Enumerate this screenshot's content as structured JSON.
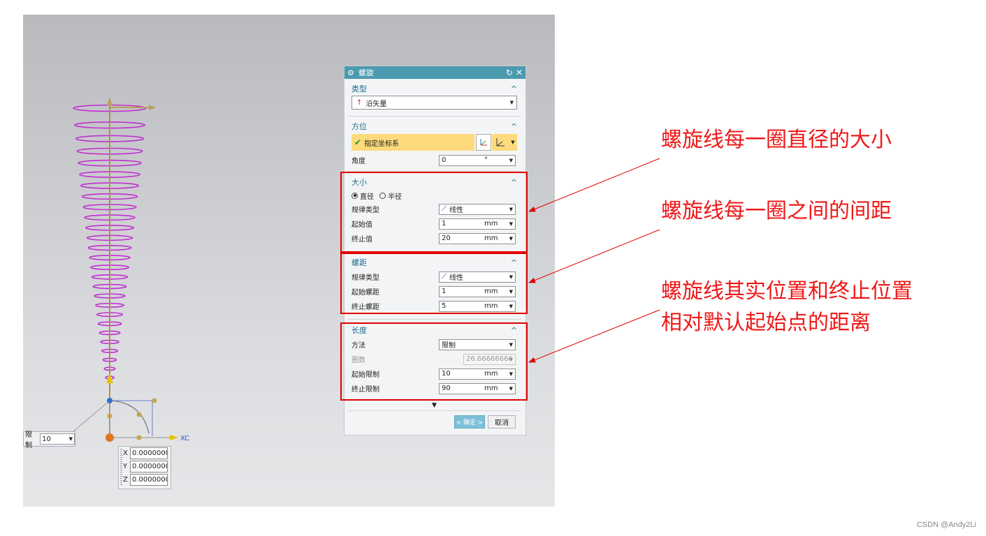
{
  "dialog": {
    "title": "螺旋",
    "type_section": {
      "header": "类型",
      "value": "沿矢量"
    },
    "orient_section": {
      "header": "方位",
      "csys_label": "指定坐标系",
      "angle_label": "角度",
      "angle_value": "0",
      "angle_unit": "°"
    },
    "size_section": {
      "header": "大小",
      "radio_diameter": "直径",
      "radio_radius": "半径",
      "law_label": "规律类型",
      "law_value": "线性",
      "start_label": "起始值",
      "start_value": "1",
      "start_unit": "mm",
      "end_label": "终止值",
      "end_value": "20",
      "end_unit": "mm"
    },
    "pitch_section": {
      "header": "螺距",
      "law_label": "规律类型",
      "law_value": "线性",
      "start_label": "起始螺距",
      "start_value": "1",
      "start_unit": "mm",
      "end_label": "终止螺距",
      "end_value": "5",
      "end_unit": "mm"
    },
    "length_section": {
      "header": "长度",
      "method_label": "方法",
      "method_value": "限制",
      "turns_label": "圈数",
      "turns_value": "26.66666666",
      "start_limit_label": "起始限制",
      "start_limit_value": "10",
      "start_limit_unit": "mm",
      "end_limit_label": "终止限制",
      "end_limit_value": "90",
      "end_limit_unit": "mm"
    },
    "ok_label": "< 确定 >",
    "cancel_label": "取消"
  },
  "viewport": {
    "limit_label": "限制",
    "limit_value": "10",
    "x_label": "X",
    "x_value": "0.0000000",
    "y_label": "Y",
    "y_value": "0.0000000",
    "z_label": "Z",
    "z_value": "0.0000000",
    "axis_x_label": "XC"
  },
  "annotations": {
    "diameter_note": "螺旋线每一圈直径的大小",
    "pitch_note": "螺旋线每一圈之间的间距",
    "length_note_line1": "螺旋线其实位置和终止位置",
    "length_note_line2": "相对默认起始点的距离"
  },
  "watermark": "CSDN @Andy2Li",
  "colors": {
    "helix": "#c030d0",
    "title_bar": "#4b9ab0",
    "annotation": "#ef1818",
    "csys_highlight": "#fddb7c"
  }
}
